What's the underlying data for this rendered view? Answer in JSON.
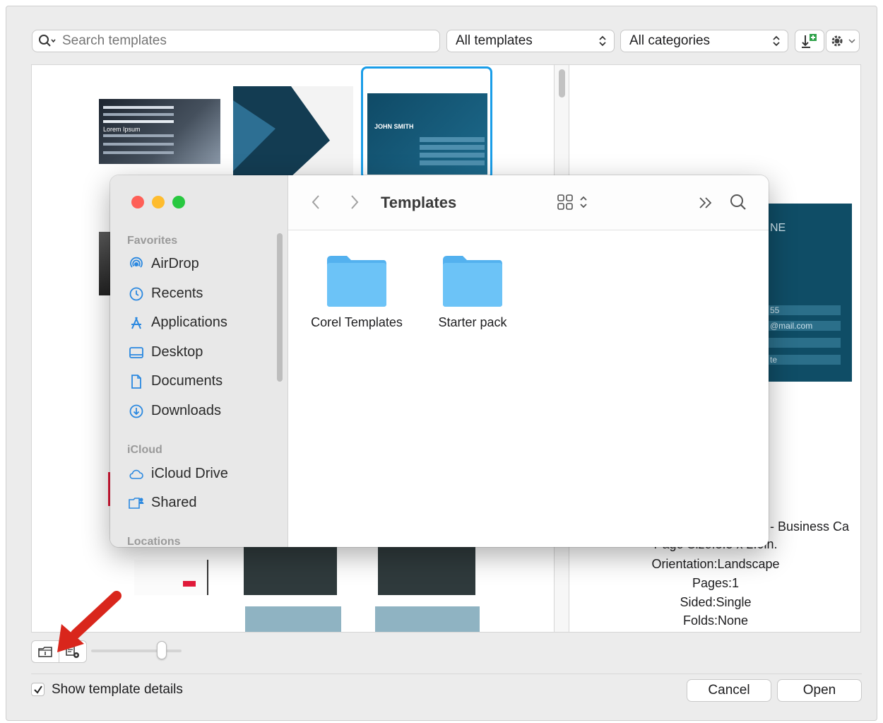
{
  "toolbar": {
    "search_placeholder": "Search templates",
    "filter_templates": "All templates",
    "filter_categories": "All categories"
  },
  "gallery": {
    "card_name": "JOHN SMITH",
    "card_line1": "Lorem Ipsum"
  },
  "details": {
    "preview_snippets": [
      "NE",
      "55",
      "@mail.com",
      "te"
    ],
    "label": "- Business Ca",
    "page_size": "Page Size:3.5 x 2.0in.",
    "orientation": "Orientation:Landscape",
    "pages": "Pages:1",
    "sided": "Sided:Single",
    "folds": "Folds:None"
  },
  "finder": {
    "title": "Templates",
    "sections": {
      "favorites": "Favorites",
      "icloud": "iCloud",
      "locations": "Locations"
    },
    "sidebar_items": [
      {
        "label": "AirDrop",
        "icon": "airdrop-icon"
      },
      {
        "label": "Recents",
        "icon": "clock-icon"
      },
      {
        "label": "Applications",
        "icon": "applications-icon"
      },
      {
        "label": "Desktop",
        "icon": "desktop-icon"
      },
      {
        "label": "Documents",
        "icon": "document-icon"
      },
      {
        "label": "Downloads",
        "icon": "download-icon"
      },
      {
        "label": "iCloud Drive",
        "icon": "cloud-icon"
      },
      {
        "label": "Shared",
        "icon": "shared-folder-icon"
      }
    ],
    "folders": [
      {
        "label": "Corel Templates"
      },
      {
        "label": "Starter pack"
      }
    ]
  },
  "bottom": {
    "show_details_label": "Show template details",
    "show_details_checked": true,
    "zoom_level": 0.78,
    "cancel_label": "Cancel",
    "open_label": "Open"
  },
  "colors": {
    "accent": "#1a9de8",
    "folder": "#6cc3f7",
    "traffic_red": "#fe5f57",
    "traffic_yellow": "#febc2e",
    "traffic_green": "#28c840",
    "arrow": "#d9261c",
    "sidebar_icon": "#2a88e0"
  }
}
